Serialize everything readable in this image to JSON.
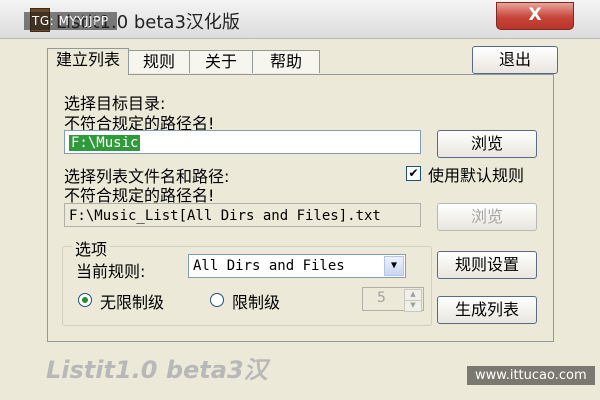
{
  "window": {
    "title": "Listit1.0 beta3汉化版",
    "close_label": "X"
  },
  "watermarks": {
    "top_left": "TG: MYYJJPP",
    "bottom_right": "www.ittucao.com"
  },
  "tabs": [
    {
      "label": "建立列表",
      "active": true
    },
    {
      "label": "规则",
      "active": false
    },
    {
      "label": "关于",
      "active": false
    },
    {
      "label": "帮助",
      "active": false
    }
  ],
  "exit_label": "退出",
  "target_dir": {
    "label_line1": "选择目标目录:",
    "label_line2": "不符合规定的路径名!",
    "value": "F:\\Music",
    "browse_label": "浏览"
  },
  "list_file": {
    "label_line1": "选择列表文件名和路径:",
    "label_line2": "不符合规定的路径名!",
    "value": "F:\\Music_List[All Dirs and Files].txt",
    "browse_label": "浏览",
    "default_rule_label": "使用默认规则",
    "default_rule_checked": true
  },
  "options": {
    "group_title": "选项",
    "current_rule_label": "当前规则:",
    "current_rule_value": "All Dirs and Files",
    "unlimited_label": "无限制级",
    "limited_label": "限制级",
    "level_value": "5",
    "rule_settings_label": "规则设置",
    "generate_label": "生成列表"
  },
  "footer_text": "Listit1.0 beta3汉",
  "colors": {
    "selection": "#2f9a3a",
    "close_button": "#c7453a"
  }
}
